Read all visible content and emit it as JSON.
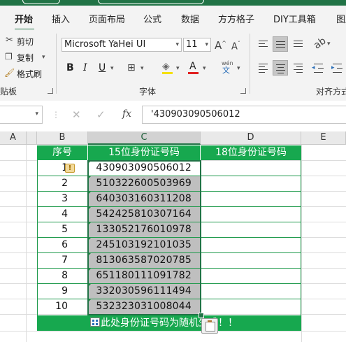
{
  "ribbon": {
    "tabs": [
      "开始",
      "插入",
      "页面布局",
      "公式",
      "数据",
      "方方格子",
      "DIY工具箱",
      "图层"
    ],
    "active_tab": "开始",
    "clipboard": {
      "cut": "剪切",
      "copy": "复制",
      "format_painter": "格式刷",
      "group_label": "贴板"
    },
    "font": {
      "name": "Microsoft YaHei UI",
      "size": "11",
      "group_label": "字体",
      "phonetic_label": "wén"
    },
    "alignment": {
      "group_label": "对齐方式"
    },
    "accent": "#217346"
  },
  "formula_bar": {
    "value": "'430903090506012"
  },
  "columns": [
    "A",
    "B",
    "C",
    "D",
    "E"
  ],
  "table": {
    "headers": [
      "序号",
      "15位身份证号码",
      "18位身份证号码"
    ],
    "rows": [
      {
        "seq": "1",
        "id15": "430903090506012",
        "id18": ""
      },
      {
        "seq": "2",
        "id15": "510322600503969",
        "id18": ""
      },
      {
        "seq": "3",
        "id15": "640303160311208",
        "id18": ""
      },
      {
        "seq": "4",
        "id15": "542425810307164",
        "id18": ""
      },
      {
        "seq": "5",
        "id15": "133052176010978",
        "id18": ""
      },
      {
        "seq": "6",
        "id15": "245103192101035",
        "id18": ""
      },
      {
        "seq": "7",
        "id15": "813063587020785",
        "id18": ""
      },
      {
        "seq": "8",
        "id15": "651180111091782",
        "id18": ""
      },
      {
        "seq": "9",
        "id15": "332030596111494",
        "id18": ""
      },
      {
        "seq": "10",
        "id15": "532323031008044",
        "id18": ""
      }
    ],
    "footer_note": "此处身份证号码为随机生成！！",
    "header_color": "#17a84f"
  }
}
